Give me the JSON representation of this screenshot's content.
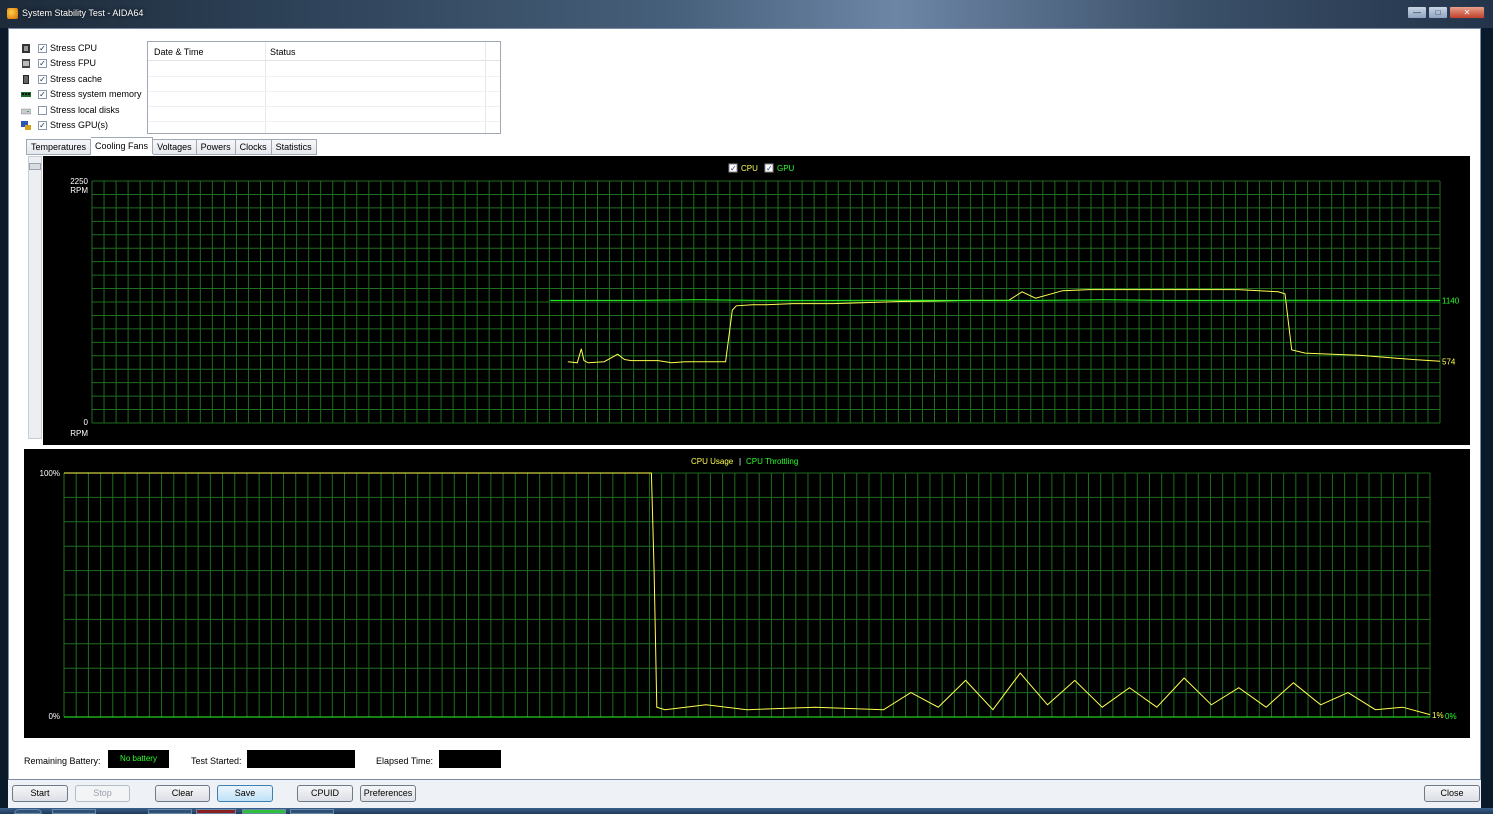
{
  "window": {
    "title": "System Stability Test - AIDA64",
    "controls": {
      "minimize": "—",
      "maximize": "□",
      "close": "✕"
    }
  },
  "stress_options": [
    {
      "label": "Stress CPU",
      "checked": true,
      "icon": "cpu-icon"
    },
    {
      "label": "Stress FPU",
      "checked": true,
      "icon": "fpu-icon"
    },
    {
      "label": "Stress cache",
      "checked": true,
      "icon": "cache-icon"
    },
    {
      "label": "Stress system memory",
      "checked": true,
      "icon": "memory-icon"
    },
    {
      "label": "Stress local disks",
      "checked": false,
      "icon": "disk-icon"
    },
    {
      "label": "Stress GPU(s)",
      "checked": true,
      "icon": "gpu-icon"
    }
  ],
  "log": {
    "columns": [
      "Date & Time",
      "Status"
    ],
    "rows": []
  },
  "tabs": [
    {
      "label": "Temperatures",
      "active": false
    },
    {
      "label": "Cooling Fans",
      "active": true
    },
    {
      "label": "Voltages",
      "active": false
    },
    {
      "label": "Powers",
      "active": false
    },
    {
      "label": "Clocks",
      "active": false
    },
    {
      "label": "Statistics",
      "active": false
    }
  ],
  "chart_data": [
    {
      "type": "line",
      "legend": [
        {
          "name": "CPU",
          "checked": true,
          "color": "#ffff50"
        },
        {
          "name": "GPU",
          "checked": true,
          "color": "#28ff28"
        }
      ],
      "y_top_label": "2250",
      "y_top_unit": "RPM",
      "y_bottom_label": "0",
      "y_bottom_unit": "RPM",
      "ylim": [
        0,
        2250
      ],
      "grid": true,
      "x": [
        0.34,
        0.36,
        0.38,
        0.42,
        0.45,
        0.47,
        0.48,
        0.5,
        0.55,
        0.6,
        0.65,
        0.68,
        0.7,
        0.72,
        0.75,
        0.8,
        0.85,
        0.88,
        0.9,
        0.93,
        0.96,
        1.0
      ],
      "series": [
        {
          "name": "CPU",
          "color": "#ffff50",
          "x": [
            0.353,
            0.36,
            0.363,
            0.365,
            0.368,
            0.38,
            0.39,
            0.395,
            0.4,
            0.42,
            0.43,
            0.44,
            0.47,
            0.475,
            0.478,
            0.49,
            0.5,
            0.52,
            0.55,
            0.6,
            0.65,
            0.68,
            0.69,
            0.7,
            0.72,
            0.74,
            0.76,
            0.8,
            0.85,
            0.88,
            0.885,
            0.89,
            0.9,
            0.92,
            0.94,
            0.96,
            0.98,
            1.0
          ],
          "y": [
            570,
            560,
            690,
            580,
            560,
            570,
            640,
            590,
            580,
            580,
            560,
            570,
            570,
            1050,
            1090,
            1100,
            1100,
            1110,
            1110,
            1130,
            1140,
            1140,
            1220,
            1160,
            1230,
            1240,
            1240,
            1240,
            1240,
            1220,
            1200,
            680,
            650,
            640,
            630,
            610,
            590,
            574
          ],
          "last_label": "574"
        },
        {
          "name": "GPU",
          "color": "#28ff28",
          "x": [
            0.34,
            0.4,
            0.45,
            0.5,
            0.55,
            0.6,
            0.65,
            0.7,
            0.75,
            0.8,
            0.85,
            0.9,
            0.95,
            1.0
          ],
          "y": [
            1140,
            1140,
            1145,
            1140,
            1140,
            1142,
            1140,
            1140,
            1145,
            1140,
            1140,
            1142,
            1140,
            1140
          ],
          "last_label": "1140"
        }
      ]
    },
    {
      "type": "line",
      "legend": [
        {
          "name": "CPU Usage",
          "color": "#ffff50"
        },
        {
          "name": "CPU Throttling",
          "color": "#28ff28"
        }
      ],
      "legend_separator": "|",
      "y_top_label": "100%",
      "y_bottom_label": "0%",
      "ylim": [
        0,
        100
      ],
      "grid": true,
      "series": [
        {
          "name": "CPU Usage",
          "color": "#ffff50",
          "x": [
            0.0,
            0.43,
            0.432,
            0.434,
            0.44,
            0.47,
            0.5,
            0.55,
            0.6,
            0.62,
            0.64,
            0.66,
            0.68,
            0.7,
            0.72,
            0.74,
            0.76,
            0.78,
            0.8,
            0.82,
            0.84,
            0.86,
            0.88,
            0.9,
            0.92,
            0.94,
            0.96,
            0.98,
            1.0
          ],
          "y": [
            100,
            100,
            60,
            4,
            3,
            5,
            3,
            4,
            3,
            10,
            4,
            15,
            3,
            18,
            5,
            15,
            4,
            12,
            4,
            16,
            5,
            12,
            4,
            14,
            5,
            10,
            3,
            4,
            1
          ],
          "last_label": "1%"
        },
        {
          "name": "CPU Throttling",
          "color": "#28ff28",
          "x": [
            0.0,
            1.0
          ],
          "y": [
            0,
            0
          ],
          "last_label": "0%"
        }
      ]
    }
  ],
  "status": {
    "battery_label": "Remaining Battery:",
    "battery_value": "No battery",
    "started_label": "Test Started:",
    "started_value": "",
    "elapsed_label": "Elapsed Time:",
    "elapsed_value": ""
  },
  "buttons": {
    "start": "Start",
    "stop": "Stop",
    "clear": "Clear",
    "save": "Save",
    "cpuid": "CPUID",
    "preferences": "Preferences",
    "close": "Close"
  }
}
